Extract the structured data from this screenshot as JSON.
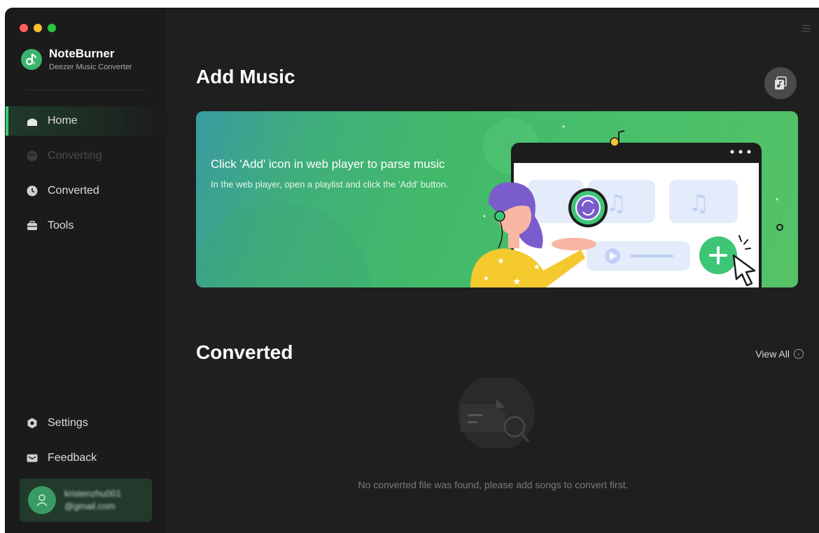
{
  "app": {
    "name": "NoteBurner",
    "subtitle": "Deezer Music Converter"
  },
  "sidebar": {
    "items": [
      {
        "label": "Home",
        "icon": "home-icon",
        "state": "active"
      },
      {
        "label": "Converting",
        "icon": "converting-icon",
        "state": "disabled"
      },
      {
        "label": "Converted",
        "icon": "clock-icon",
        "state": "normal"
      },
      {
        "label": "Tools",
        "icon": "toolbox-icon",
        "state": "normal"
      }
    ],
    "bottom_items": [
      {
        "label": "Settings",
        "icon": "gear-icon"
      },
      {
        "label": "Feedback",
        "icon": "mail-icon"
      }
    ],
    "user": {
      "email_line1": "kristenzhu001",
      "email_line2": "@gmail.com"
    }
  },
  "main": {
    "add_music_title": "Add Music",
    "banner": {
      "title": "Click 'Add' icon in web player to parse music",
      "subtitle": "In the web player, open a playlist and click the 'Add' button."
    },
    "converted_title": "Converted",
    "view_all_label": "View All",
    "empty_message": "No converted file was found, please add songs to convert first."
  },
  "colors": {
    "accent": "#3ec677",
    "background": "#1f1f1f",
    "sidebar": "#1b1b1b"
  }
}
